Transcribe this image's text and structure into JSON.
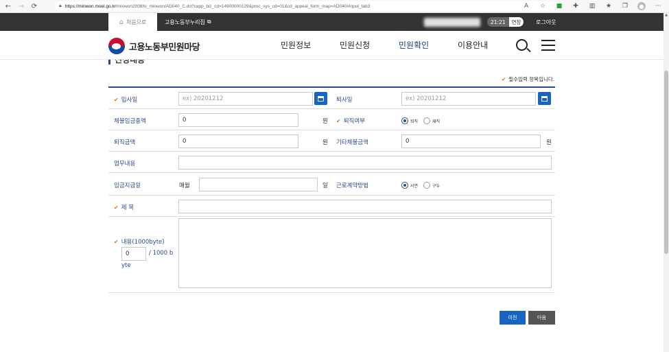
{
  "browser": {
    "url_host": "https://minwon.moel.go.kr",
    "url_rest": "/minwon2008/lc_minwon/AD040_C.do?capp_biz_cd=14900000129&proc_sys_cd=01&cd_appeal_form_map=AD040#input_tab3"
  },
  "topbar": {
    "home": "처음으로",
    "nuri": "고용노동부누리집",
    "session_time": "21:21",
    "extend": "연장",
    "logout": "로그아웃"
  },
  "header": {
    "logo_text": "고용노동부민원마당",
    "menu": [
      "민원정보",
      "민원신청",
      "민원확인",
      "이용안내"
    ]
  },
  "section": {
    "title": "신청내용",
    "required_note": "필수입력 항목입니다."
  },
  "form": {
    "join_date": {
      "label": "입사일",
      "placeholder": "ex) 20201212"
    },
    "leave_date": {
      "label": "퇴사일",
      "placeholder": "ex) 20201212"
    },
    "unpaid_total": {
      "label": "체불임금총액",
      "value": "0",
      "unit": "원"
    },
    "retired": {
      "label": "퇴직여부",
      "options": [
        "퇴직",
        "재직"
      ],
      "selected": "퇴직"
    },
    "severance": {
      "label": "퇴직금액",
      "value": "0",
      "unit": "원"
    },
    "other_unpaid": {
      "label": "기타체불금액",
      "value": "0",
      "unit": "원"
    },
    "job_desc": {
      "label": "업무내용",
      "value": ""
    },
    "pay_day": {
      "label": "임금지급일",
      "prefix": "매월",
      "value": "",
      "unit": "일"
    },
    "contract_method": {
      "label": "근로계약방법",
      "options": [
        "서면",
        "구두"
      ],
      "selected": "서면"
    },
    "subject": {
      "label": "제 목",
      "value": ""
    },
    "content": {
      "label": "내용(1000byte)",
      "count": "0",
      "limit_1": "/ 1000 b",
      "limit_2": "yte"
    }
  },
  "buttons": {
    "prev": "이전",
    "next": "다음"
  },
  "colors": {
    "accent": "#1765c1",
    "navy": "#2a4a8c",
    "check": "#e06a1a"
  }
}
